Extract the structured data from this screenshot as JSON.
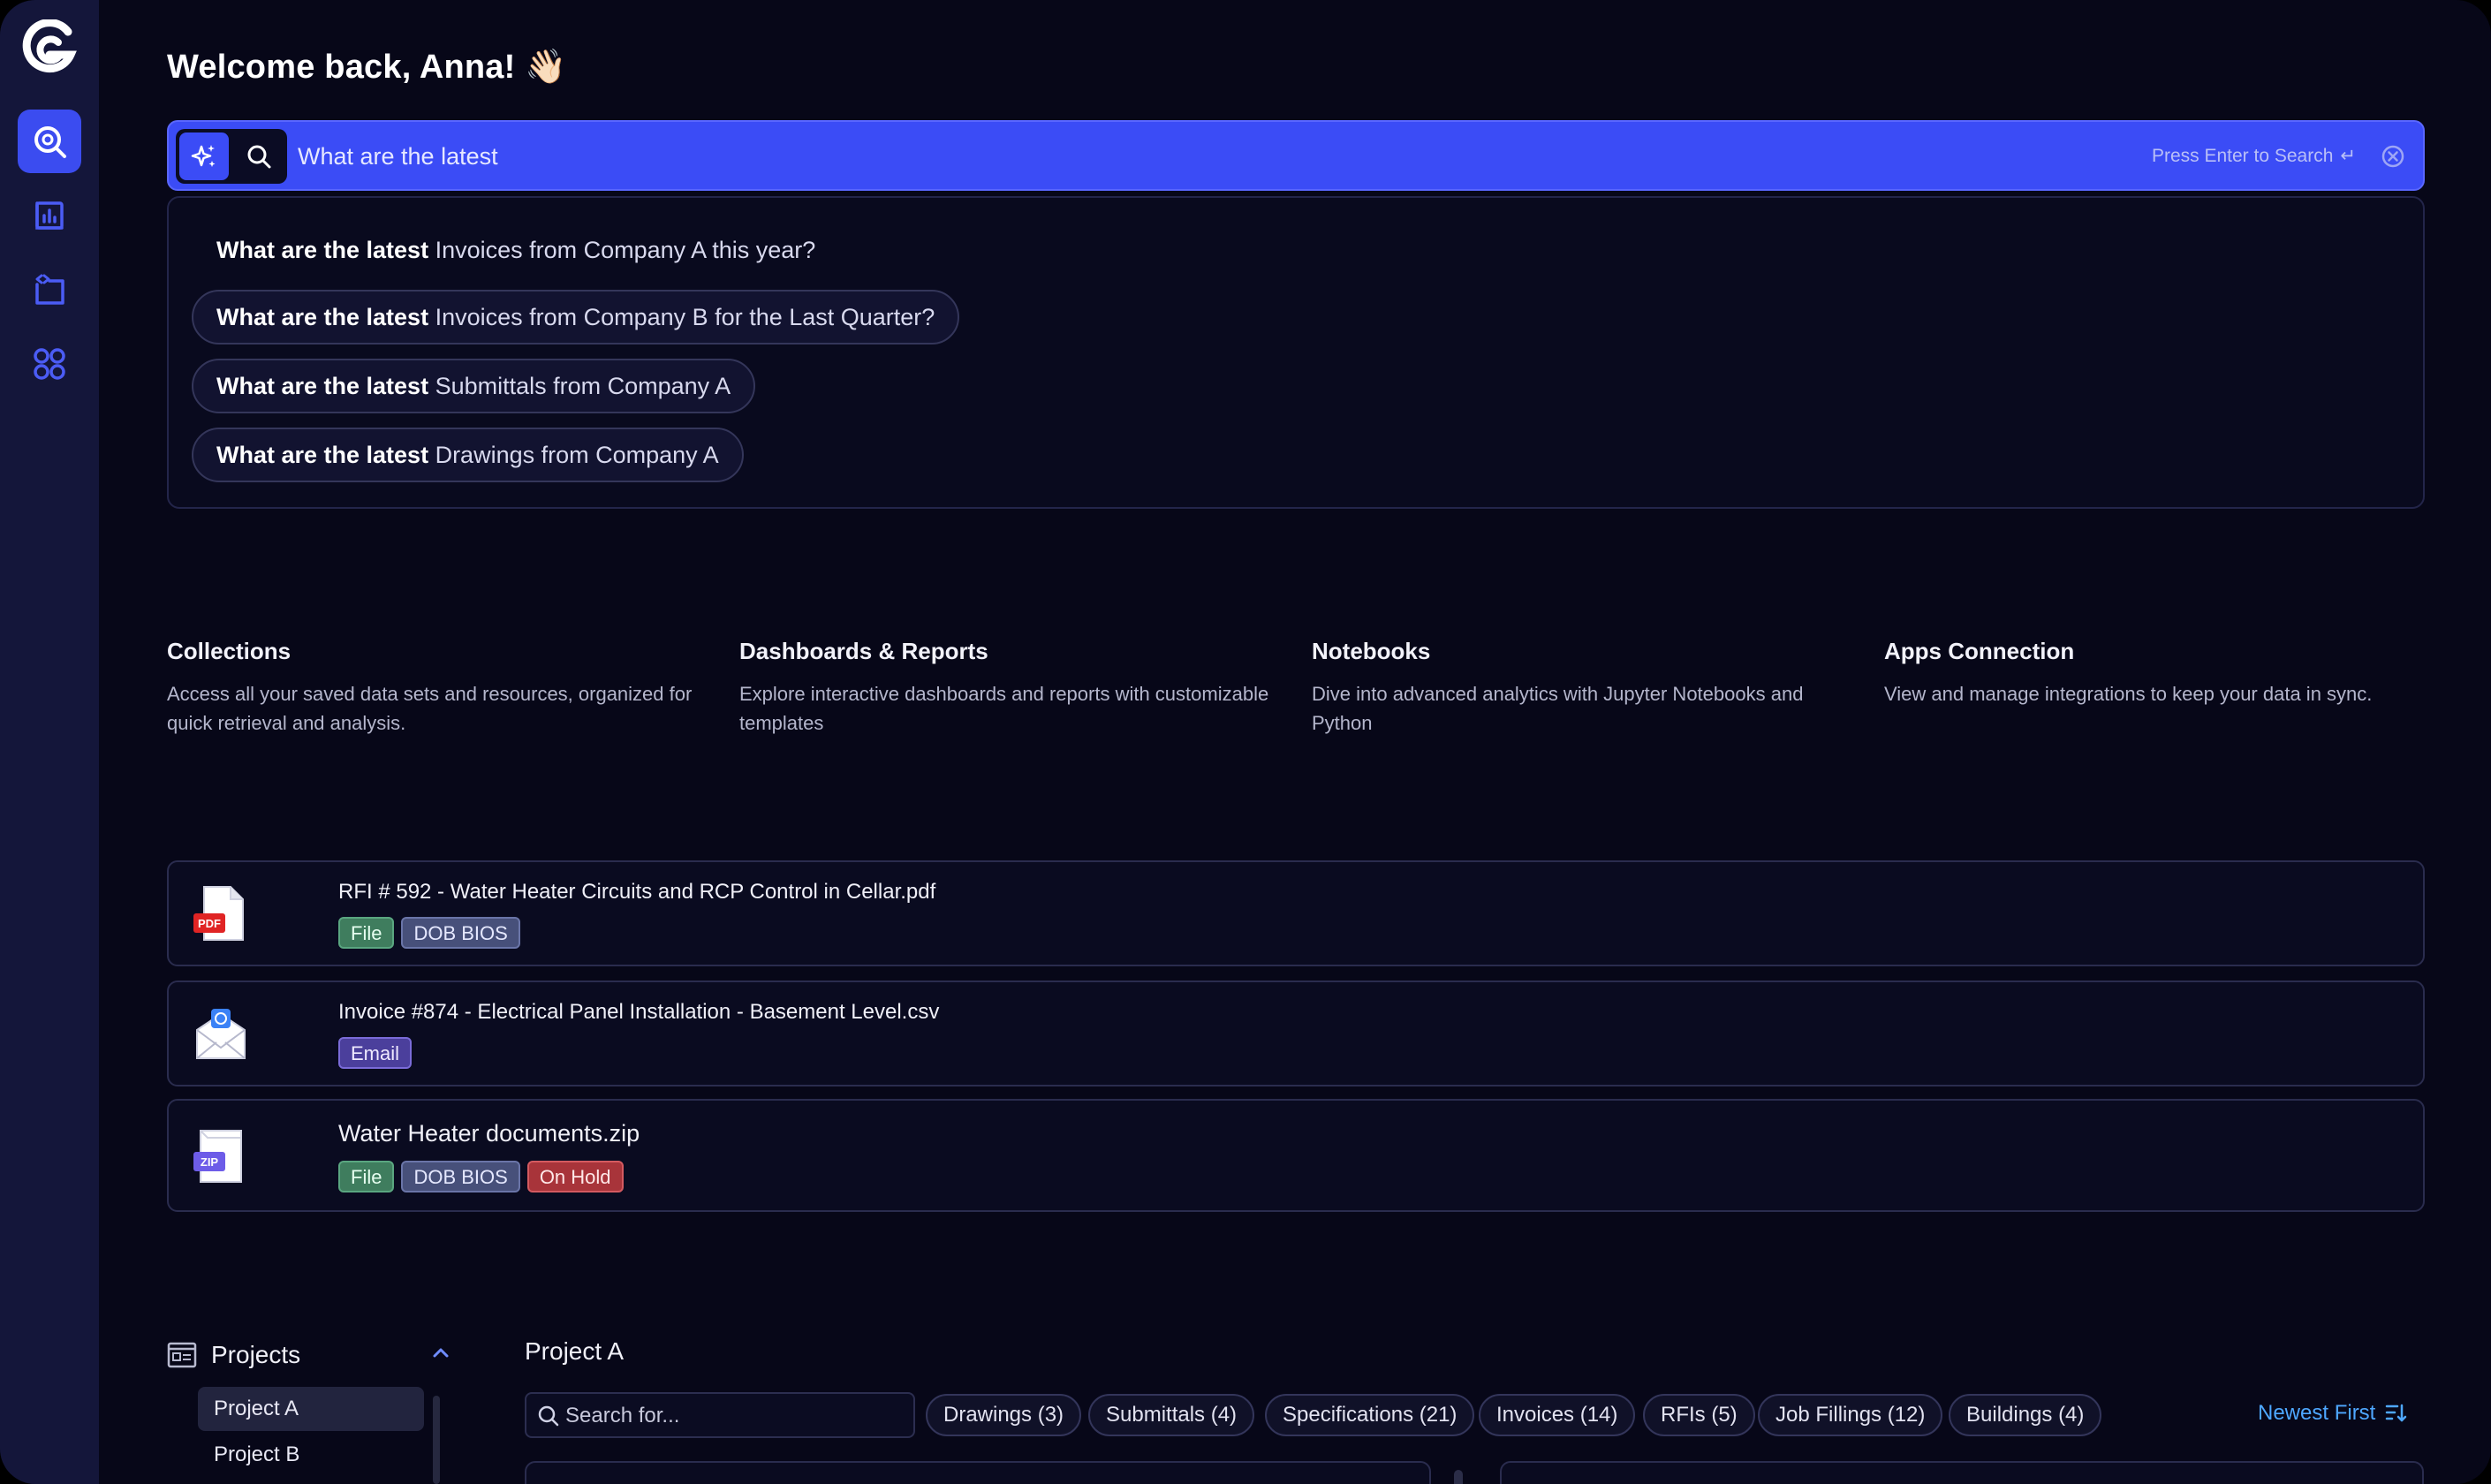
{
  "welcome": "Welcome back, Anna! 👋🏻",
  "search": {
    "value": "What are the latest",
    "hint": "Press Enter to Search",
    "enter_symbol": "↵"
  },
  "suggestions": [
    {
      "bold": "What are the latest",
      "rest": " Invoices from Company A this year?"
    },
    {
      "bold": "What are the latest",
      "rest": " Invoices from Company B for the Last Quarter?"
    },
    {
      "bold": "What are the latest",
      "rest": " Submittals from Company A"
    },
    {
      "bold": "What are the latest",
      "rest": " Drawings from Company A"
    }
  ],
  "cards": [
    {
      "title": "Collections",
      "desc": "Access all your saved data sets and resources, organized for quick retrieval and analysis."
    },
    {
      "title": "Dashboards & Reports",
      "desc": "Explore interactive dashboards and reports with customizable templates"
    },
    {
      "title": "Notebooks",
      "desc": "Dive into advanced analytics with Jupyter Notebooks and Python"
    },
    {
      "title": "Apps Connection",
      "desc": "View and manage integrations to keep your data in sync."
    }
  ],
  "files": [
    {
      "name": "RFI # 592 - Water Heater Circuits and RCP Control in Cellar.pdf",
      "icon": "pdf-file-icon",
      "badge": "PDF",
      "tags": [
        "File",
        "DOB BIOS"
      ]
    },
    {
      "name": "Invoice #874 - Electrical Panel Installation - Basement Level.csv",
      "icon": "email-envelope-icon",
      "tags": [
        "Email"
      ]
    },
    {
      "name": "Water Heater documents.zip",
      "icon": "zip-file-icon",
      "badge": "ZIP",
      "tags": [
        "File",
        "DOB BIOS",
        "On Hold"
      ]
    }
  ],
  "projects": {
    "heading": "Projects",
    "items": [
      "Project A",
      "Project B"
    ],
    "selected_title": "Project A",
    "search_placeholder": "Search for...",
    "filters": [
      "Drawings (3)",
      "Submittals (4)",
      "Specifications (21)",
      "Invoices (14)",
      "RFIs (5)",
      "Job Fillings (12)",
      "Buildings (4)"
    ],
    "sort_label": "Newest First"
  },
  "colors": {
    "accent": "#3b4cf6",
    "sidebar": "#14163a",
    "background": "#070718",
    "link": "#4ea7ff"
  }
}
